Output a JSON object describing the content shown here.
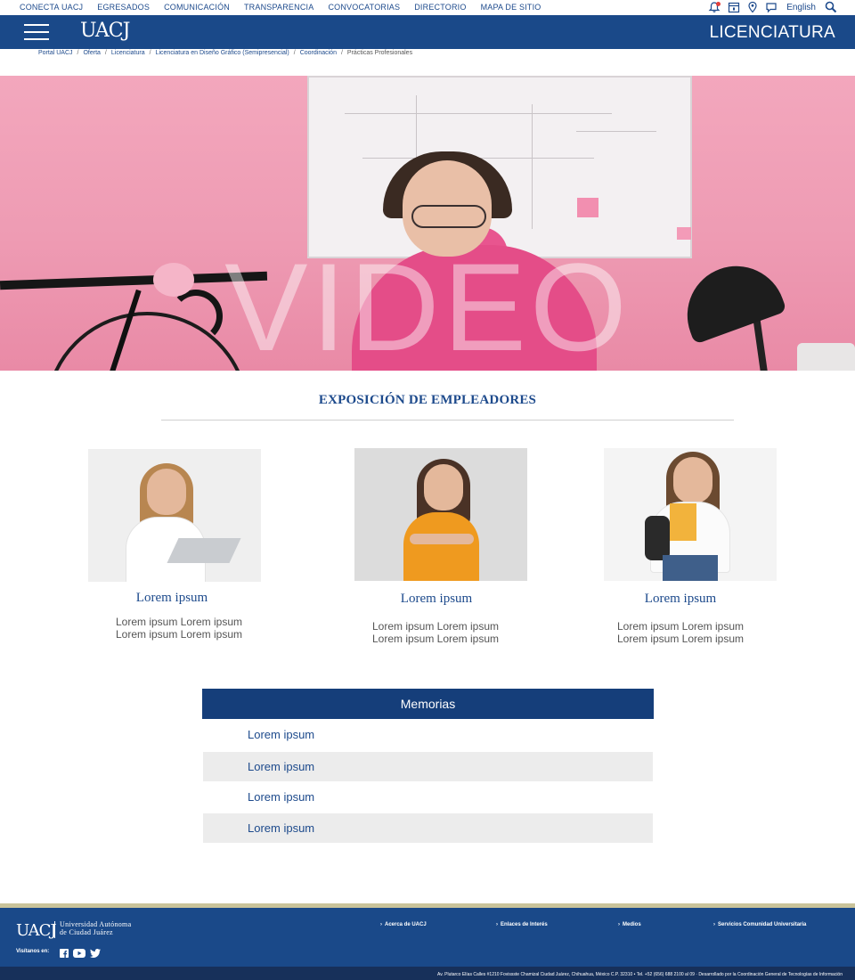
{
  "topnav": {
    "links": [
      "CONECTA UACJ",
      "EGRESADOS",
      "COMUNICACIÓN",
      "TRANSPARENCIA",
      "CONVOCATORIAS",
      "DIRECTORIO",
      "MAPA DE SITIO"
    ],
    "language": "English",
    "icons": [
      "bell-icon",
      "calendar-icon",
      "location-pin-icon",
      "chat-icon",
      "search-icon"
    ]
  },
  "header": {
    "logo": "UACJ",
    "section_title": "LICENCIATURA"
  },
  "breadcrumb": [
    "Portal UACJ",
    "Oferta",
    "Licenciatura",
    "Licenciatura en Diseño Gráfico (Semipresencial)",
    "Coordinación",
    "Prácticas Profesionales"
  ],
  "hero": {
    "overlay_text": "VIDEO"
  },
  "expo": {
    "title": "EXPOSICIÓN DE EMPLEADORES",
    "cards": [
      {
        "title": "Lorem ipsum",
        "line1": "Lorem ipsum Lorem ipsum",
        "line2": "Lorem ipsum Lorem ipsum"
      },
      {
        "title": "Lorem ipsum",
        "line1": "Lorem ipsum Lorem ipsum",
        "line2": "Lorem ipsum Lorem ipsum"
      },
      {
        "title": "Lorem ipsum",
        "line1": "Lorem ipsum Lorem ipsum",
        "line2": "Lorem ipsum Lorem ipsum"
      }
    ]
  },
  "memorias": {
    "heading": "Memorias",
    "items": [
      "Lorem ipsum",
      "Lorem ipsum",
      "Lorem ipsum",
      "Lorem ipsum"
    ]
  },
  "footer": {
    "logo": "UACJ",
    "university_line1": "Universidad Autónoma",
    "university_line2": "de Ciudad Juárez",
    "visit_label": "Visítanos en:",
    "social_icons": [
      "facebook-icon",
      "youtube-icon",
      "twitter-icon"
    ],
    "links": [
      "Acerca de UACJ",
      "Enlaces de Interés",
      "Medios",
      "Servicios Comunidad Universitaria"
    ],
    "address": "Av. Plutarco Elías Calles #1210 Fovissste Chamizal Ciudad Juárez, Chihuahua, México C.P. 32310 • Tel. +52 (656) 688 2100 al 09 · Desarrollado por la Coordinación General de Tecnologías de Información"
  },
  "colors": {
    "brand_blue": "#1a4989",
    "memorias_blue": "#153e7a",
    "footer_accent": "#c9c39a"
  }
}
